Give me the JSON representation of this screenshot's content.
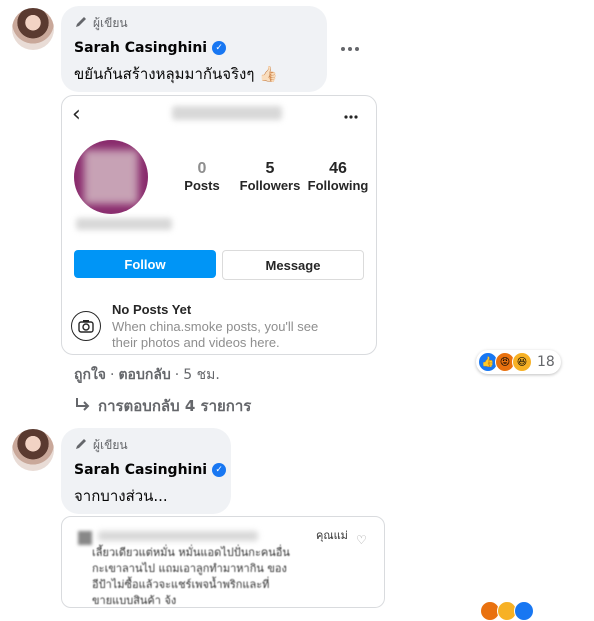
{
  "comment1": {
    "author_tag": "ผู้เขียน",
    "author_name": "Sarah Casinghini",
    "text": "ขยันกันสร้างหลุมมากันจริงๆ 👍🏻",
    "more_icon": "more-horizontal-icon",
    "ig_card": {
      "stats": [
        {
          "value": "0",
          "label": "Posts"
        },
        {
          "value": "5",
          "label": "Followers"
        },
        {
          "value": "46",
          "label": "Following"
        }
      ],
      "follow_label": "Follow",
      "message_label": "Message",
      "no_posts_title": "No Posts Yet",
      "no_posts_text_1": "When china.smoke posts, you'll see",
      "no_posts_text_2": "their photos and videos here."
    },
    "actions": {
      "like": "ถูกใจ",
      "reply": "ตอบกลับ",
      "time": "5 ชม."
    },
    "reaction_count": "18",
    "replies_link": "การตอบกลับ 4 รายการ"
  },
  "comment2": {
    "author_tag": "ผู้เขียน",
    "author_name": "Sarah Casinghini",
    "text": "จากบางส่วน..."
  },
  "screenshot_card": {
    "line_1": "คุณแม่",
    "line_2": "เลี้ยวเดียวแต่หมั่น หมั่นแอดไปปั่นกะคนอื่น",
    "line_3": "กะเขาลานไป แถมเอาลูกทำมาหากิน ของ",
    "line_4": "อีป้าไม่ซื้อแล้วจะแชร์เพจน้ำพริกและที่",
    "line_5": "ขายแบบสินค้า จ้ง"
  },
  "colors": {
    "accent": "#1877f2",
    "ig_blue": "#0095f6",
    "bubble": "#f0f2f5",
    "muted": "#65676b"
  }
}
